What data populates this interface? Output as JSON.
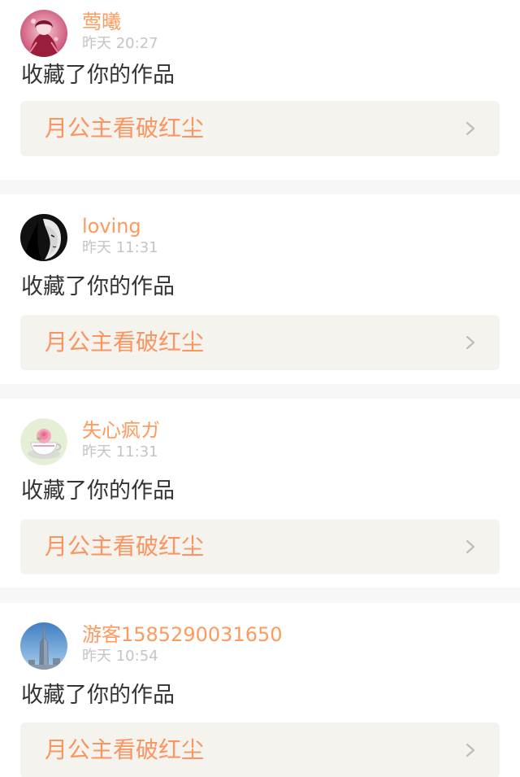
{
  "notifications": [
    {
      "username": "莺曦",
      "time": "昨天 20:27",
      "action": "收藏了你的作品",
      "work_title": "月公主看破红尘",
      "avatar_icon": "anime-girl-avatar"
    },
    {
      "username": "loving",
      "time": "昨天 11:31",
      "action": "收藏了你的作品",
      "work_title": "月公主看破红尘",
      "avatar_icon": "dark-woman-portrait-avatar"
    },
    {
      "username": "失心疯ガ",
      "time": "昨天 11:31",
      "action": "收藏了你的作品",
      "work_title": "月公主看破红尘",
      "avatar_icon": "teacup-rose-avatar"
    },
    {
      "username": "游客1585290031650",
      "time": "昨天 10:54",
      "action": "收藏了你的作品",
      "work_title": "月公主看破红尘",
      "avatar_icon": "skyscraper-avatar"
    }
  ],
  "colors": {
    "username": "#ff9a5c",
    "timestamp": "#c4c4c4",
    "action_text": "#333333",
    "work_title": "#fa9460",
    "work_box_bg": "#f4f3ee",
    "divider_bg": "#f7f7f7"
  }
}
